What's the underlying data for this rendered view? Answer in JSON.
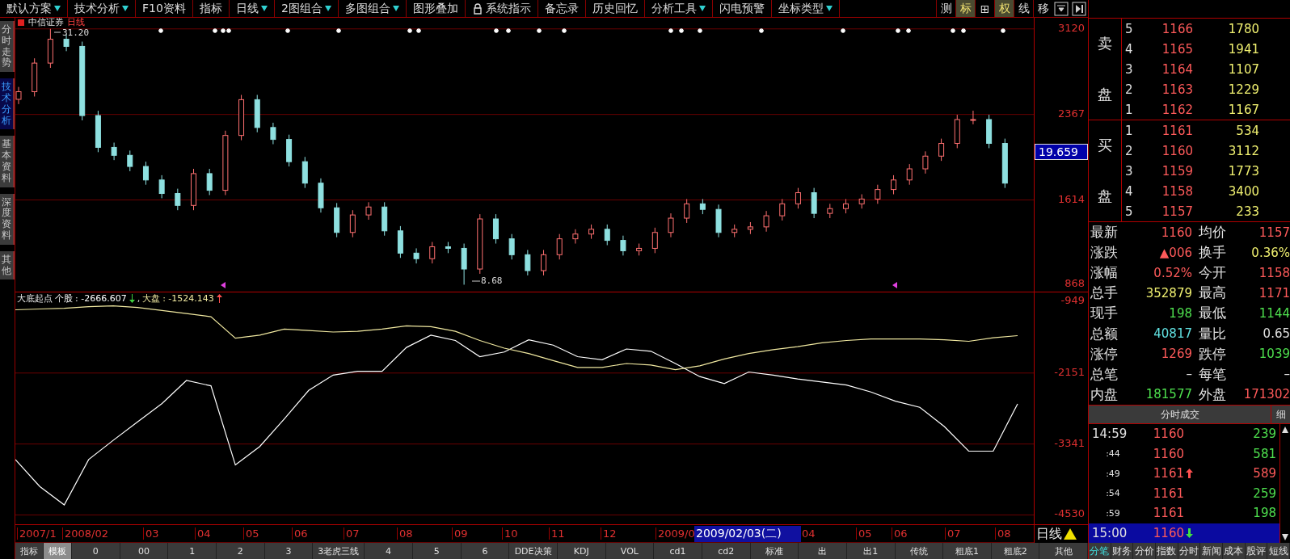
{
  "toolbar": {
    "items": [
      {
        "label": "默认方案",
        "dropdown": true,
        "lock_icon": false
      },
      {
        "label": "技术分析",
        "dropdown": true,
        "lock_icon": false
      },
      {
        "label": "F10资料",
        "dropdown": false,
        "lock_icon": false
      },
      {
        "label": "指标",
        "dropdown": false,
        "lock_icon": false
      },
      {
        "label": "日线",
        "dropdown": true,
        "lock_icon": false
      },
      {
        "label": "2图组合",
        "dropdown": true,
        "lock_icon": false
      },
      {
        "label": "多图组合",
        "dropdown": true,
        "lock_icon": false
      },
      {
        "label": "图形叠加",
        "dropdown": false,
        "lock_icon": false
      },
      {
        "label": "系统指示",
        "dropdown": false,
        "lock_icon": true
      },
      {
        "label": "备忘录",
        "dropdown": false,
        "lock_icon": false
      },
      {
        "label": "历史回忆",
        "dropdown": false,
        "lock_icon": false
      },
      {
        "label": "分析工具",
        "dropdown": true,
        "lock_icon": false
      },
      {
        "label": "闪电预警",
        "dropdown": false,
        "lock_icon": false
      },
      {
        "label": "坐标类型",
        "dropdown": true,
        "lock_icon": false
      }
    ],
    "view_buttons": [
      {
        "label": "测",
        "selected": false
      },
      {
        "label": "标",
        "selected": true
      },
      {
        "label": "⊞",
        "selected": false
      },
      {
        "label": "权",
        "selected": true
      },
      {
        "label": "线",
        "selected": false
      },
      {
        "label": "移",
        "selected": false
      }
    ]
  },
  "side_tabs": [
    {
      "label": "分时走势",
      "selected": false
    },
    {
      "label": "技术分析",
      "selected": true
    },
    {
      "label": "基本资料",
      "selected": false
    },
    {
      "label": "深度资料",
      "selected": false
    },
    {
      "label": "其他",
      "selected": false
    }
  ],
  "price_chart": {
    "stock_name": "中信证券",
    "period": "日线",
    "high_label": "31.20",
    "low_label": "8.68",
    "cursor_value": "19.659",
    "chart_data": {
      "type": "candlestick",
      "grid": true,
      "ylim": [
        800,
        3218
      ],
      "yticks": [
        3120,
        2367,
        1614,
        868
      ],
      "ohlc": [
        [
          2500,
          2609,
          2458,
          2567
        ],
        [
          2567,
          2861,
          2525,
          2819
        ],
        [
          2819,
          3120,
          2777,
          3029
        ],
        [
          3029,
          3071,
          2924,
          2966
        ],
        [
          2966,
          3008,
          2315,
          2357
        ],
        [
          2357,
          2399,
          2035,
          2077
        ],
        [
          2077,
          2119,
          1965,
          2007
        ],
        [
          2007,
          2049,
          1867,
          1909
        ],
        [
          1909,
          1951,
          1748,
          1790
        ],
        [
          1790,
          1832,
          1629,
          1671
        ],
        [
          1671,
          1713,
          1524,
          1566
        ],
        [
          1566,
          1888,
          1524,
          1846
        ],
        [
          1846,
          1888,
          1657,
          1699
        ],
        [
          1699,
          2224,
          1657,
          2182
        ],
        [
          2182,
          2539,
          2140,
          2497
        ],
        [
          2497,
          2539,
          2210,
          2252
        ],
        [
          2252,
          2294,
          2105,
          2147
        ],
        [
          2147,
          2189,
          1909,
          1951
        ],
        [
          1951,
          1993,
          1720,
          1762
        ],
        [
          1762,
          1804,
          1503,
          1545
        ],
        [
          1545,
          1587,
          1286,
          1328
        ],
        [
          1328,
          1524,
          1286,
          1482
        ],
        [
          1482,
          1594,
          1440,
          1552
        ],
        [
          1552,
          1594,
          1300,
          1342
        ],
        [
          1342,
          1384,
          1104,
          1146
        ],
        [
          1146,
          1188,
          1055,
          1097
        ],
        [
          1097,
          1244,
          1055,
          1202
        ],
        [
          1202,
          1244,
          1146,
          1188
        ],
        [
          1188,
          1230,
          868,
          1006
        ],
        [
          1006,
          1489,
          964,
          1447
        ],
        [
          1447,
          1489,
          1230,
          1272
        ],
        [
          1272,
          1314,
          1090,
          1132
        ],
        [
          1132,
          1174,
          950,
          992
        ],
        [
          992,
          1174,
          950,
          1132
        ],
        [
          1132,
          1314,
          1090,
          1272
        ],
        [
          1272,
          1356,
          1230,
          1314
        ],
        [
          1314,
          1398,
          1272,
          1356
        ],
        [
          1356,
          1398,
          1216,
          1258
        ],
        [
          1258,
          1300,
          1125,
          1167
        ],
        [
          1167,
          1230,
          1125,
          1188
        ],
        [
          1188,
          1370,
          1146,
          1328
        ],
        [
          1328,
          1496,
          1286,
          1454
        ],
        [
          1454,
          1622,
          1412,
          1580
        ],
        [
          1580,
          1622,
          1489,
          1531
        ],
        [
          1531,
          1573,
          1286,
          1328
        ],
        [
          1328,
          1398,
          1286,
          1356
        ],
        [
          1356,
          1419,
          1314,
          1377
        ],
        [
          1377,
          1517,
          1335,
          1475
        ],
        [
          1475,
          1622,
          1433,
          1580
        ],
        [
          1580,
          1720,
          1538,
          1678
        ],
        [
          1678,
          1720,
          1454,
          1496
        ],
        [
          1496,
          1580,
          1454,
          1538
        ],
        [
          1538,
          1622,
          1496,
          1580
        ],
        [
          1580,
          1664,
          1538,
          1622
        ],
        [
          1622,
          1748,
          1580,
          1706
        ],
        [
          1706,
          1832,
          1664,
          1790
        ],
        [
          1790,
          1930,
          1748,
          1888
        ],
        [
          1888,
          2042,
          1846,
          2000
        ],
        [
          2000,
          2154,
          1958,
          2112
        ],
        [
          2112,
          2364,
          2070,
          2322
        ],
        [
          2322,
          2400,
          2280,
          2322
        ],
        [
          2322,
          2364,
          2070,
          2112
        ],
        [
          2112,
          2154,
          1720,
          1762
        ]
      ]
    }
  },
  "indicator": {
    "name": "大底起点",
    "readings": [
      {
        "value": ": -2666.607",
        "rising": false,
        "separator": ","
      },
      {
        "value": ": -1524.143",
        "rising": true
      }
    ],
    "chart_data": {
      "type": "line",
      "grid": true,
      "ylim": [
        -4700,
        -800
      ],
      "yticks": [
        {
          "value": -949,
          "label": "-949"
        },
        {
          "value": -2151,
          "label": "-2151"
        },
        {
          "value": -3341,
          "label": "-3341"
        },
        {
          "value": -4530,
          "label": "-4530"
        }
      ],
      "series": [
        {
          "name": "个股",
          "color": "#ffffff",
          "values": [
            -3602,
            -4053,
            -4362,
            -3602,
            -3280,
            -2971,
            -2662,
            -2276,
            -2366,
            -3692,
            -3383,
            -2920,
            -2443,
            -2185,
            -2121,
            -2121,
            -1722,
            -1516,
            -1606,
            -1876,
            -1799,
            -1593,
            -1683,
            -1876,
            -1928,
            -1748,
            -1786,
            -1992,
            -2211,
            -2327,
            -2134,
            -2185,
            -2250,
            -2301,
            -2353,
            -2469,
            -2623,
            -2726,
            -3048,
            -3461,
            -3461,
            -2667
          ]
        },
        {
          "name": "大盘",
          "color": "#f0e8a0",
          "values": [
            -1091,
            -1078,
            -1065,
            -1039,
            -1026,
            -1052,
            -1104,
            -1155,
            -1207,
            -1567,
            -1516,
            -1413,
            -1438,
            -1464,
            -1451,
            -1413,
            -1361,
            -1374,
            -1451,
            -1606,
            -1735,
            -1825,
            -1941,
            -2057,
            -2057,
            -1992,
            -2018,
            -2095,
            -2031,
            -1915,
            -1825,
            -1760,
            -1709,
            -1645,
            -1606,
            -1580,
            -1580,
            -1580,
            -1593,
            -1619,
            -1560,
            -1524
          ]
        }
      ]
    }
  },
  "date_axis": {
    "labels": [
      "2007/1",
      "2008/02",
      "03",
      "04",
      "05",
      "06",
      "07",
      "08",
      "09",
      "10",
      "11",
      "12",
      "2009/0",
      "04",
      "05",
      "06",
      "07",
      "08"
    ],
    "cursor_date": "2009/02/03(二)",
    "period": "日线"
  },
  "bottom_tabs": [
    {
      "label": "指标",
      "selected": false
    },
    {
      "label": "模板",
      "selected": true
    },
    {
      "label": "0",
      "selected": false
    },
    {
      "label": "00",
      "selected": false
    },
    {
      "label": "1",
      "selected": false
    },
    {
      "label": "2",
      "selected": false
    },
    {
      "label": "3",
      "selected": false
    },
    {
      "label": "3老虎三线",
      "selected": false
    },
    {
      "label": "4",
      "selected": false
    },
    {
      "label": "5",
      "selected": false
    },
    {
      "label": "6",
      "selected": false
    },
    {
      "label": "DDE决策",
      "selected": false
    },
    {
      "label": "KDJ",
      "selected": false
    },
    {
      "label": "VOL",
      "selected": false
    },
    {
      "label": "cd1",
      "selected": false
    },
    {
      "label": "cd2",
      "selected": false
    },
    {
      "label": "标准",
      "selected": false
    },
    {
      "label": "出",
      "selected": false
    },
    {
      "label": "出1",
      "selected": false
    },
    {
      "label": "传统",
      "selected": false
    },
    {
      "label": "粗底1",
      "selected": false
    },
    {
      "label": "粗底2",
      "selected": false
    },
    {
      "label": "其他",
      "selected": false
    }
  ],
  "quote": {
    "ask": {
      "side_label": [
        "卖",
        "盘"
      ],
      "rows": [
        {
          "rank": "5",
          "price": "1166",
          "volume": "1780"
        },
        {
          "rank": "4",
          "price": "1165",
          "volume": "1941"
        },
        {
          "rank": "3",
          "price": "1164",
          "volume": "1107"
        },
        {
          "rank": "2",
          "price": "1163",
          "volume": "1229"
        },
        {
          "rank": "1",
          "price": "1162",
          "volume": "1167"
        }
      ]
    },
    "bid": {
      "side_label": [
        "买",
        "盘"
      ],
      "rows": [
        {
          "rank": "1",
          "price": "1161",
          "volume": "534"
        },
        {
          "rank": "2",
          "price": "1160",
          "volume": "3112"
        },
        {
          "rank": "3",
          "price": "1159",
          "volume": "1773"
        },
        {
          "rank": "4",
          "price": "1158",
          "volume": "3400"
        },
        {
          "rank": "5",
          "price": "1157",
          "volume": "233"
        }
      ]
    },
    "stats": [
      {
        "left": {
          "label": "最新",
          "value": "1160",
          "color": "#ff5a5a"
        },
        "right": {
          "label": "均价",
          "value": "1157",
          "color": "#ff5a5a"
        }
      },
      {
        "left": {
          "label": "涨跌",
          "value": "▲006",
          "color": "#ff5a5a"
        },
        "right": {
          "label": "换手",
          "value": "0.36%",
          "color": "#f0f070"
        }
      },
      {
        "left": {
          "label": "涨幅",
          "value": "0.52%",
          "color": "#ff5a5a"
        },
        "right": {
          "label": "今开",
          "value": "1158",
          "color": "#ff5a5a"
        }
      },
      {
        "left": {
          "label": "总手",
          "value": "352879",
          "color": "#f0f070"
        },
        "right": {
          "label": "最高",
          "value": "1171",
          "color": "#ff5a5a"
        }
      },
      {
        "left": {
          "label": "现手",
          "value": "198",
          "color": "#4ee04e"
        },
        "right": {
          "label": "最低",
          "value": "1144",
          "color": "#4ee04e"
        }
      },
      {
        "left": {
          "label": "总额",
          "value": "40817",
          "color": "#60e0e0"
        },
        "right": {
          "label": "量比",
          "value": "0.65",
          "color": "#e0e0e0"
        }
      },
      {
        "left": {
          "label": "涨停",
          "value": "1269",
          "color": "#ff5a5a"
        },
        "right": {
          "label": "跌停",
          "value": "1039",
          "color": "#4ee04e"
        }
      },
      {
        "left": {
          "label": "总笔",
          "value": "–",
          "color": "#e0e0e0"
        },
        "right": {
          "label": "每笔",
          "value": "–",
          "color": "#e0e0e0"
        }
      },
      {
        "left": {
          "label": "内盘",
          "value": "181577",
          "color": "#4ee04e"
        },
        "right": {
          "label": "外盘",
          "value": "171302",
          "color": "#ff5a5a"
        }
      }
    ]
  },
  "trades": {
    "title": "分时成交",
    "detail_button": "细",
    "rows": [
      {
        "time": "14:59",
        "price": "1160",
        "volume": "239",
        "color": "#4ee04e",
        "tick_up": false,
        "tick_down": false,
        "selected": false
      },
      {
        "time": ":44",
        "price": "1160",
        "volume": "581",
        "color": "#4ee04e",
        "tick_up": false,
        "tick_down": false,
        "selected": false
      },
      {
        "time": ":49",
        "price": "1161",
        "volume": "589",
        "color": "#ff5a5a",
        "tick_up": true,
        "tick_down": false,
        "selected": false
      },
      {
        "time": ":54",
        "price": "1161",
        "volume": "259",
        "color": "#4ee04e",
        "tick_up": false,
        "tick_down": false,
        "selected": false
      },
      {
        "time": ":59",
        "price": "1161",
        "volume": "198",
        "color": "#4ee04e",
        "tick_up": false,
        "tick_down": false,
        "selected": false
      },
      {
        "time": "15:00",
        "price": "1160",
        "tick_up": false,
        "tick_down": true,
        "selected": true
      }
    ]
  },
  "panel_tabs": [
    {
      "label": "分笔",
      "selected": true
    },
    {
      "label": "财务",
      "selected": false
    },
    {
      "label": "分价",
      "selected": false
    },
    {
      "label": "指数",
      "selected": false
    },
    {
      "label": "分时",
      "selected": false
    },
    {
      "label": "新闻",
      "selected": false
    },
    {
      "label": "成本",
      "selected": false
    },
    {
      "label": "股评",
      "selected": false
    },
    {
      "label": "短线",
      "selected": false
    }
  ]
}
